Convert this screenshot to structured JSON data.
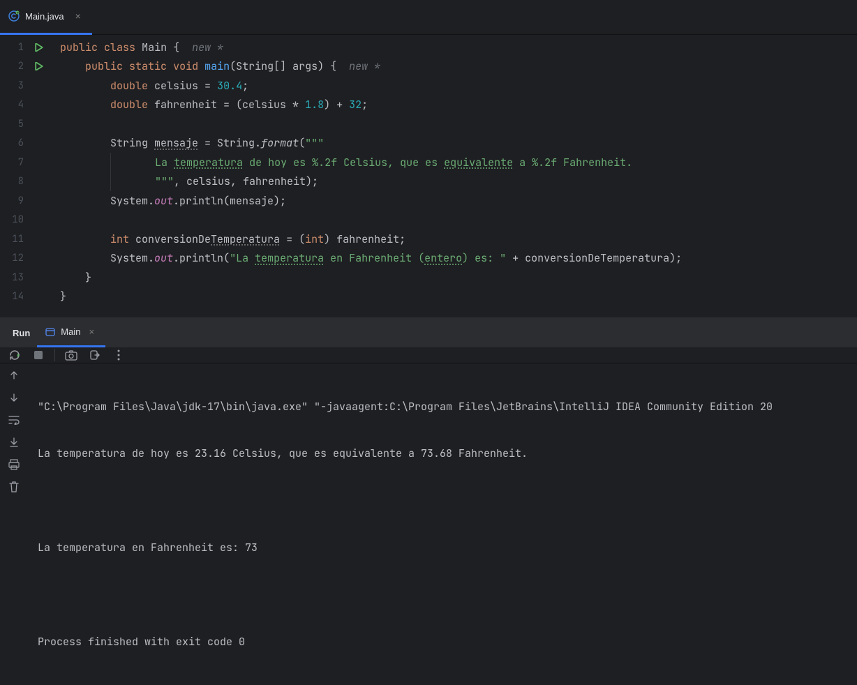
{
  "editor_tab": {
    "label": "Main.java"
  },
  "gutter": {
    "lines": [
      "1",
      "2",
      "3",
      "4",
      "5",
      "6",
      "7",
      "8",
      "9",
      "10",
      "11",
      "12",
      "13",
      "14"
    ]
  },
  "code": {
    "l1": {
      "kw1": "public",
      "kw2": "class",
      "cls": "Main",
      "brace": "{",
      "hint": "new *"
    },
    "l2": {
      "kw1": "public",
      "kw2": "static",
      "kw3": "void",
      "fn": "main",
      "args": "(String[] args) {",
      "hint": "new *"
    },
    "l3": {
      "kw": "double",
      "var": "celsius = ",
      "num": "30.4",
      "end": ";"
    },
    "l4": {
      "kw": "double",
      "var": "fahrenheit = (celsius * ",
      "num1": "1.8",
      "mid": ") + ",
      "num2": "32",
      "end": ";"
    },
    "l6": {
      "t1": "String ",
      "u": "mensaje",
      "t2": " = String.",
      "fn": "format",
      "t3": "(",
      "str": "\"\"\""
    },
    "l7": {
      "t1": "La ",
      "u1": "temperatura",
      "t2": " de hoy es %.2f Celsius, que es ",
      "u2": "equivalente",
      "t3": " a %.2f Fahrenheit."
    },
    "l8": {
      "str": "\"\"\"",
      "t": ", celsius, fahrenheit);"
    },
    "l9": {
      "t1": "System.",
      "f": "out",
      "t2": ".println(mensaje);"
    },
    "l11": {
      "kw": "int",
      "t1": " conversionDe",
      "u": "Temperatura",
      "t2": " = (",
      "kw2": "int",
      "t3": ") fahrenheit;"
    },
    "l12": {
      "t1": "System.",
      "f": "out",
      "t2": ".println(",
      "s1": "\"La ",
      "u1": "temperatura",
      "s2": " en Fahrenheit (",
      "u2": "entero",
      "s3": ") es: \"",
      "t3": " + conversionDeTemperatura);"
    },
    "l13": {
      "brace": "}"
    },
    "l14": {
      "brace": "}"
    }
  },
  "run": {
    "label": "Run",
    "tab": "Main",
    "console": {
      "l1": "\"C:\\Program Files\\Java\\jdk-17\\bin\\java.exe\" \"-javaagent:C:\\Program Files\\JetBrains\\IntelliJ IDEA Community Edition 20",
      "l2": "La temperatura de hoy es 23.16 Celsius, que es equivalente a 73.68 Fahrenheit.",
      "l3": "",
      "l4": "La temperatura en Fahrenheit es: 73",
      "l5": "",
      "l6": "Process finished with exit code 0"
    }
  }
}
